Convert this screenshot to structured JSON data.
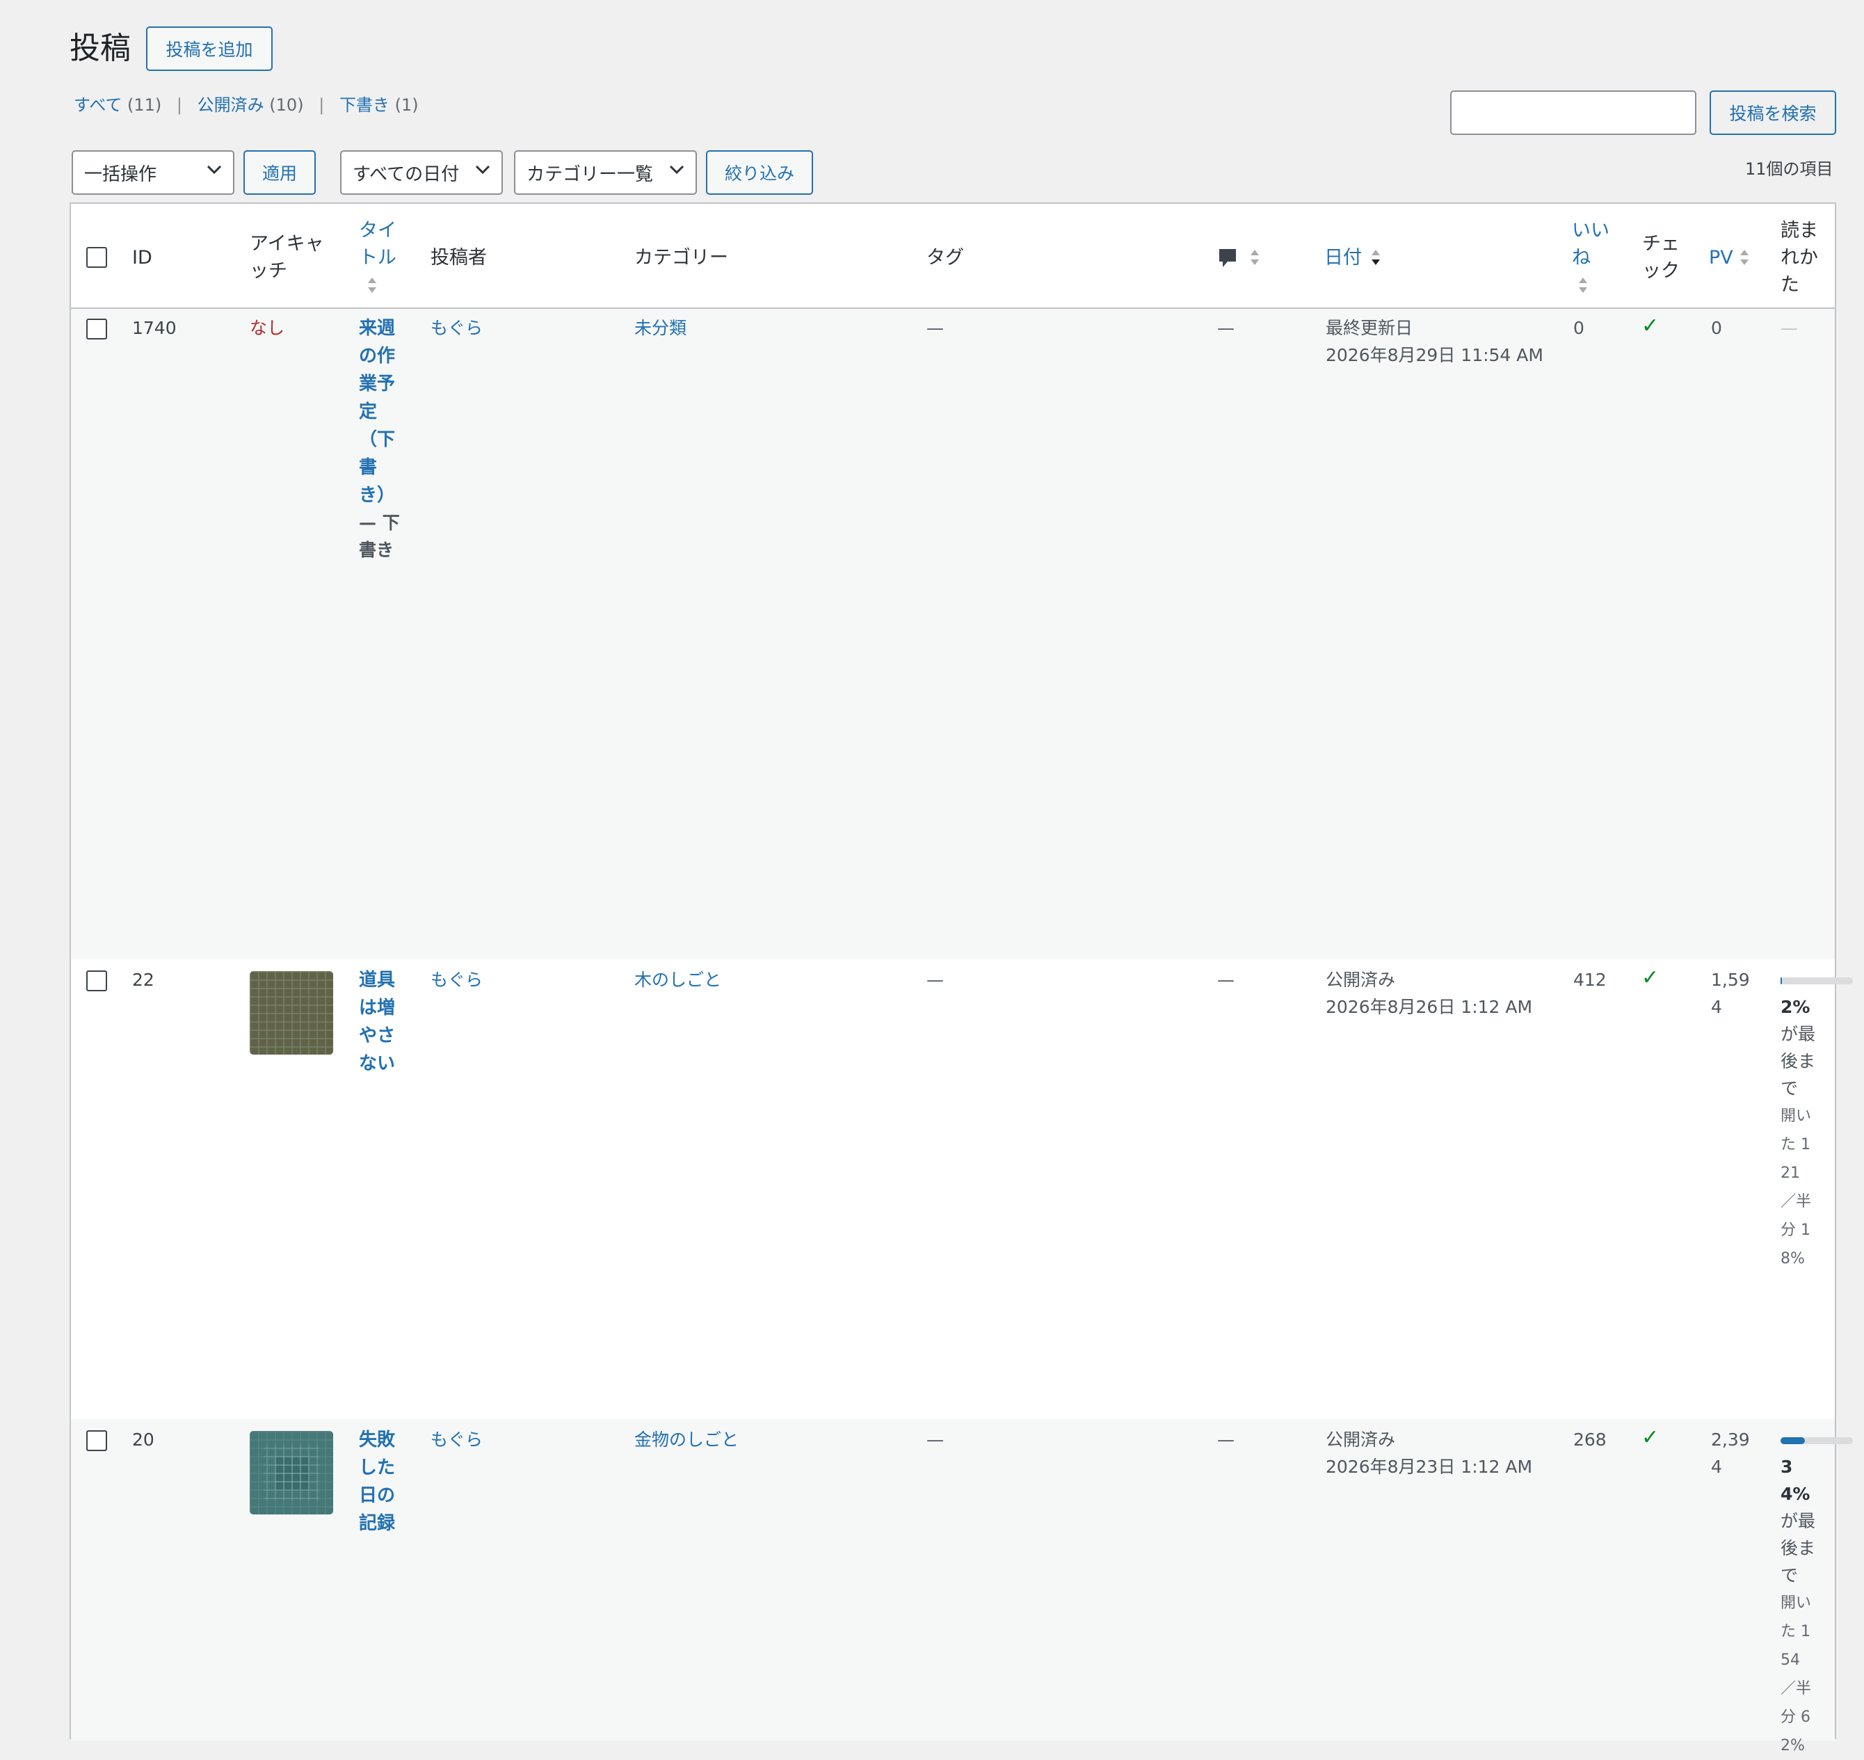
{
  "header": {
    "title": "投稿",
    "add_new_label": "投稿を追加"
  },
  "filters": {
    "all_label": "すべて",
    "all_count": "(11)",
    "published_label": "公開済み",
    "published_count": "(10)",
    "draft_label": "下書き",
    "draft_count": "(1)",
    "separator": "|"
  },
  "search": {
    "button_label": "投稿を検索",
    "placeholder": ""
  },
  "toolbar": {
    "bulk_label": "一括操作",
    "apply_label": "適用",
    "dates_label": "すべての日付",
    "categories_label": "カテゴリー一覧",
    "filter_label": "絞り込み",
    "item_count": "11個の項目"
  },
  "columns": {
    "id": "ID",
    "thumb": "アイキャッチ",
    "title": "タイトル",
    "author": "投稿者",
    "categories": "カテゴリー",
    "tags": "タグ",
    "date": "日付",
    "likes": "いいね",
    "check": "チェック",
    "pv": "PV",
    "read": "読まれかた"
  },
  "rows": [
    {
      "id": "1740",
      "thumb": "なし",
      "title": "来週の作業予定（下書き）",
      "state": "— 下書き",
      "author": "もぐら",
      "category": "未分類",
      "tags": "—",
      "comments": "—",
      "date_status": "最終更新日",
      "date": "2026年8月29日 11:54 AM",
      "likes": "0",
      "check": "✓",
      "pv": "0",
      "read": "—"
    },
    {
      "id": "22",
      "title": "道具は増やさない",
      "author": "もぐら",
      "category": "木のしごと",
      "tags": "—",
      "comments": "—",
      "date_status": "公開済み",
      "date": "2026年8月26日 1:12 AM",
      "likes": "412",
      "check": "✓",
      "pv": "1,594",
      "read_pct": "2%",
      "read_rate": 0.02,
      "read_text": "が最後まで",
      "read_detail": "開いた 121 ／半分 18%"
    },
    {
      "id": "20",
      "title": "失敗した日の記録",
      "author": "もぐら",
      "category": "金物のしごと",
      "tags": "—",
      "comments": "—",
      "date_status": "公開済み",
      "date": "2026年8月23日 1:12 AM",
      "likes": "268",
      "check": "✓",
      "pv": "2,394",
      "read_pct": "34%",
      "read_rate": 0.34,
      "read_text": "が最後まで",
      "read_detail": "開いた 154 ／半分 62%"
    }
  ]
}
